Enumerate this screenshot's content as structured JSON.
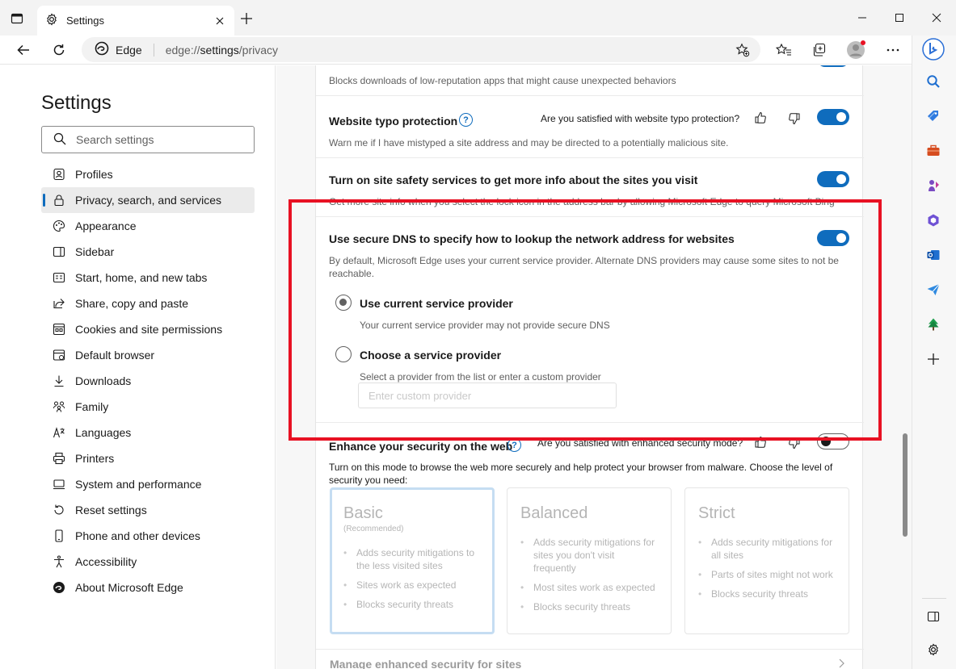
{
  "window": {
    "tab_title": "Settings"
  },
  "address_bar": {
    "site_label": "Edge",
    "url_scheme": "edge://",
    "url_host": "settings",
    "url_path": "/privacy"
  },
  "sidebar": {
    "title": "Settings",
    "search_placeholder": "Search settings",
    "items": [
      {
        "label": "Profiles",
        "icon": "profile-icon"
      },
      {
        "label": "Privacy, search, and services",
        "icon": "lock-icon",
        "active": true
      },
      {
        "label": "Appearance",
        "icon": "palette-icon"
      },
      {
        "label": "Sidebar",
        "icon": "sidebar-icon"
      },
      {
        "label": "Start, home, and new tabs",
        "icon": "home-tabs-icon"
      },
      {
        "label": "Share, copy and paste",
        "icon": "share-icon"
      },
      {
        "label": "Cookies and site permissions",
        "icon": "cookies-icon"
      },
      {
        "label": "Default browser",
        "icon": "browser-icon"
      },
      {
        "label": "Downloads",
        "icon": "download-icon"
      },
      {
        "label": "Family",
        "icon": "family-icon"
      },
      {
        "label": "Languages",
        "icon": "languages-icon"
      },
      {
        "label": "Printers",
        "icon": "printer-icon"
      },
      {
        "label": "System and performance",
        "icon": "system-icon"
      },
      {
        "label": "Reset settings",
        "icon": "reset-icon"
      },
      {
        "label": "Phone and other devices",
        "icon": "phone-icon"
      },
      {
        "label": "Accessibility",
        "icon": "accessibility-icon"
      },
      {
        "label": "About Microsoft Edge",
        "icon": "edge-logo-icon"
      }
    ]
  },
  "content": {
    "smartscreen_desc": "Blocks downloads of low-reputation apps that might cause unexpected behaviors",
    "typo": {
      "title": "Website typo protection",
      "feedback": "Are you satisfied with website typo protection?",
      "desc": "Warn me if I have mistyped a site address and may be directed to a potentially malicious site.",
      "enabled": true
    },
    "site_safety": {
      "title": "Turn on site safety services to get more info about the sites you visit",
      "desc": "Get more site info when you select the lock icon in the address bar by allowing Microsoft Edge to query Microsoft Bing",
      "enabled": true
    },
    "secure_dns": {
      "title": "Use secure DNS to specify how to lookup the network address for websites",
      "desc": "By default, Microsoft Edge uses your current service provider. Alternate DNS providers may cause some sites to not be reachable.",
      "enabled": true,
      "option_current_label": "Use current service provider",
      "option_current_desc": "Your current service provider may not provide secure DNS",
      "option_choose_label": "Choose a service provider",
      "option_choose_desc": "Select a provider from the list or enter a custom provider",
      "custom_placeholder": "Enter custom provider",
      "selected": "current"
    },
    "enhanced": {
      "title": "Enhance your security on the web",
      "feedback": "Are you satisfied with enhanced security mode?",
      "desc": "Turn on this mode to browse the web more securely and help protect your browser from malware. Choose the level of security you need:",
      "enabled": false,
      "modes": [
        {
          "name": "Basic",
          "sub": "(Recommended)",
          "bullets": [
            "Adds security mitigations to the less visited sites",
            "Sites work as expected",
            "Blocks security threats"
          ],
          "selected": true
        },
        {
          "name": "Balanced",
          "sub": "",
          "bullets": [
            "Adds security mitigations for sites you don't visit frequently",
            "Most sites work as expected",
            "Blocks security threats"
          ],
          "selected": false
        },
        {
          "name": "Strict",
          "sub": "",
          "bullets": [
            "Adds security mitigations for all sites",
            "Parts of sites might not work",
            "Blocks security threats"
          ],
          "selected": false
        }
      ],
      "manage_link": "Manage enhanced security for sites"
    }
  },
  "colors": {
    "accent": "#0f6cbd",
    "highlight": "#e81123"
  }
}
